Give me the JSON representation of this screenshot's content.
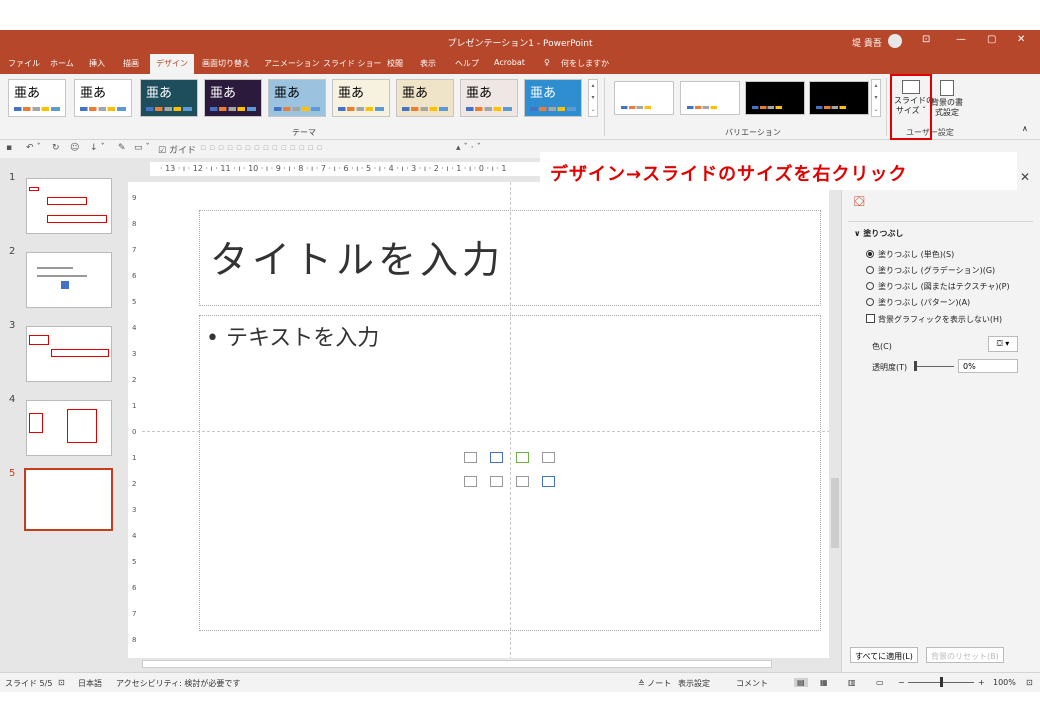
{
  "titlebar": {
    "title": "プレゼンテーション1  -  PowerPoint",
    "user": "堤 貴吾",
    "minimize": "—",
    "restore": "▢",
    "close": "✕",
    "ribbon_display": "⊡"
  },
  "tabs": [
    "ファイル",
    "ホーム",
    "挿入",
    "描画",
    "デザイン",
    "画面切り替え",
    "アニメーション",
    "スライド ショー",
    "校閲",
    "表示",
    "ヘルプ",
    "Acrobat"
  ],
  "active_tab": "デザイン",
  "tell_me": "何をしますか",
  "ribbon": {
    "themes_sample": "亜あ",
    "themes_group_label": "テーマ",
    "variants_group_label": "バリエーション",
    "slide_size": "スライドの\nサイズ ˇ",
    "background_format": "背景の書\n式設定",
    "customize_group_label": "ユーザー設定",
    "collapse": "∧"
  },
  "qat": {
    "guide_label": "ガイド"
  },
  "slides": [
    {
      "number": "1"
    },
    {
      "number": "2"
    },
    {
      "number": "3"
    },
    {
      "number": "4"
    },
    {
      "number": "5"
    }
  ],
  "ruler_h": "· 13 · ı · 12 · ı · 11 · ı · 10 · ı · 9 · ı · 8 · ı · 7 · ı · 6 · ı · 5 · ı · 4 · ı · 3 · ı · 2 · ı · 1 · ı · 0 · ı · 1",
  "ruler_v": [
    "9",
    "8",
    "7",
    "6",
    "5",
    "4",
    "3",
    "2",
    "1",
    "0",
    "1",
    "2",
    "3",
    "4",
    "5",
    "6",
    "7",
    "8"
  ],
  "slide": {
    "title_placeholder": "タイトルを入力",
    "body_placeholder": "• テキストを入力"
  },
  "callout": "デザイン→スライドのサイズを右クリック",
  "format_pane": {
    "section": "∨ 塗りつぶし",
    "options": [
      "塗りつぶし (単色)(S)",
      "塗りつぶし (グラデーション)(G)",
      "塗りつぶし (図またはテクスチャ)(P)",
      "塗りつぶし (パターン)(A)"
    ],
    "hide_background_graphics": "背景グラフィックを表示しない(H)",
    "color_label": "色(C)",
    "transparency_label": "透明度(T)",
    "transparency_value": "0%",
    "apply_all": "すべてに適用(L)",
    "reset_background": "背景のリセット(B)"
  },
  "status": {
    "slide_counter": "スライド 5/5",
    "language": "日本語",
    "accessibility": "アクセシビリティ: 検討が必要です",
    "notes": "≙ ノート",
    "display_settings": "表示設定",
    "comments": "コメント",
    "zoom": "100%"
  },
  "colors": {
    "accent": "#b7472a",
    "active_slide": "#c43e1c",
    "highlight": "#e00000"
  }
}
